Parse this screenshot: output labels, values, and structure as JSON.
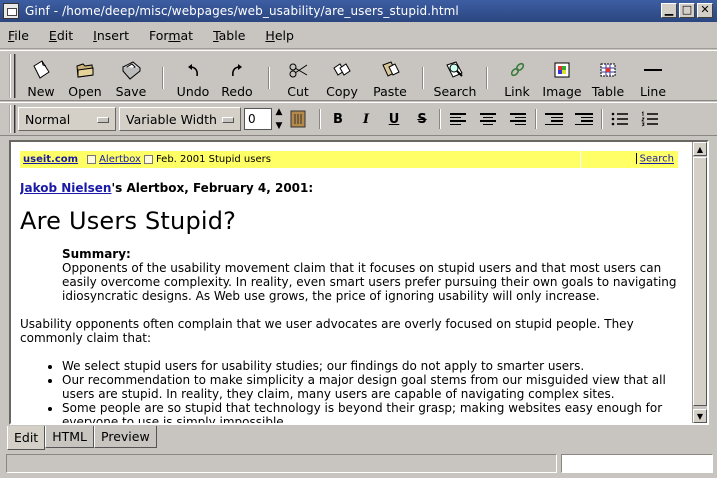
{
  "window": {
    "title": "Ginf - /home/deep/misc/webpages/web_usability/are_users_stupid.html",
    "controls": [
      "minimize",
      "maximize",
      "close"
    ]
  },
  "menu": [
    {
      "label": "File",
      "mnemonic": "F",
      "rest": "ile"
    },
    {
      "label": "Edit",
      "mnemonic": "E",
      "rest": "dit"
    },
    {
      "label": "Insert",
      "mnemonic": "I",
      "rest": "nsert"
    },
    {
      "label": "Format",
      "pre": "For",
      "mnemonic": "m",
      "rest": "at"
    },
    {
      "label": "Table",
      "mnemonic": "T",
      "rest": "able"
    },
    {
      "label": "Help",
      "mnemonic": "H",
      "rest": "elp"
    }
  ],
  "toolbar": {
    "new": "New",
    "open": "Open",
    "save": "Save",
    "undo": "Undo",
    "redo": "Redo",
    "cut": "Cut",
    "copy": "Copy",
    "paste": "Paste",
    "search": "Search",
    "link": "Link",
    "image": "Image",
    "table": "Table",
    "line": "Line"
  },
  "format": {
    "paragraph_style": "Normal",
    "font": "Variable Width",
    "font_size": "0"
  },
  "document": {
    "nav": {
      "site": "useit.com",
      "alertbox": "Alertbox",
      "issue": "Feb. 2001 Stupid users",
      "search": "Search"
    },
    "byline_author": "Jakob Nielsen",
    "byline_rest": "'s Alertbox, February 4, 2001:",
    "title": "Are Users Stupid?",
    "summary_label": "Summary:",
    "summary_text": "Opponents of the usability movement claim that it focuses on stupid users and that most users can easily overcome complexity. In reality, even smart users prefer pursuing their own goals to navigating idiosyncratic designs. As Web use grows, the price of ignoring usability will only increase.",
    "intro": "Usability opponents often complain that we user advocates are overly focused on stupid people. They commonly claim that:",
    "bullets": [
      "We select stupid users for usability studies; our findings do not apply to smarter users.",
      "Our recommendation to make simplicity a major design goal stems from our misguided view that all users are stupid. In reality, they claim, many users are capable of navigating complex sites.",
      "Some people are so stupid that technology is beyond their grasp; making websites easy enough for everyone to use is simply impossible."
    ]
  },
  "tabs": [
    "Edit",
    "HTML",
    "Preview"
  ],
  "active_tab": "Edit",
  "colors": {
    "titlebar": "#2f4c8c",
    "nav_strip": "#ffff66",
    "link": "#1a1aa6"
  }
}
